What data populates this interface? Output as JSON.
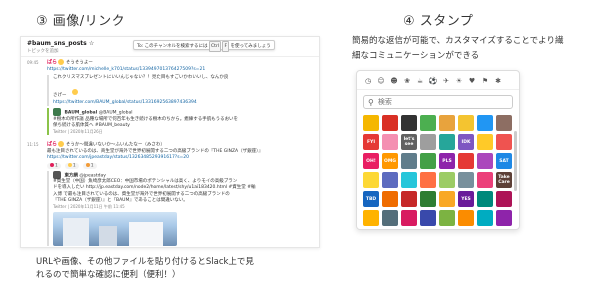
{
  "left": {
    "heading": "③ 画像/リンク",
    "channel_name": "#baum_sns_posts ☆",
    "channel_topic": "トピックを追加",
    "tooltip_pre": "To: このチャンネルを検索するには",
    "tooltip_key1": "Ctrl",
    "tooltip_key2": "F",
    "tooltip_post": "を使ってみましょう",
    "messages": [
      {
        "ts": "09:45",
        "author": "ぱら",
        "text": "そうそうよー",
        "link1": "https://twitter.com/michelle_k701/status/133949701376427509?s=21",
        "line1": "これクリスマスプレゼントにいいんじゃない？！見た目もすごいかわいいし、なんか良",
        "line2": "さげー",
        "link2": "https://twitter.com/BAUM_global/status/1331692563897436394",
        "quote_author": "BAUM_global",
        "quote_handle": "@BAUM_global",
        "quote_text1": "#樹木の所作謳 品種な場所で何百年も生き続ける樹木のちから。癒練する手肌もうるおいを",
        "quote_text2": "保ち続ける肌体質へ #BAUM_beauty",
        "quote_date": "Twitter | 2020年11月26日"
      },
      {
        "ts": "11:15",
        "author": "ぱら",
        "text": "そうか〜間違いないか〜ふいんたなー（みさわ）",
        "line1": "最も注目されているのは、商生堂が海外で世界初展開する二つの高級ブランドの『THE GINZA（ザ銀座）』",
        "link1": "https://twitter.com/jpeastday/status/1326348529391617?s=20",
        "r1": "1",
        "r2": "1",
        "r3": "1",
        "quote_author": "東方網",
        "quote_handle": "@jpeastday",
        "quote_text1": "#資生堂（中国）魚崎彦太郎CEO：中国市場のポテンシャルは高く、よりモイの高級ブラン",
        "quote_text2": "ドを導入したい http://jp.eastday.com/node2/home/latest/shy/u1ai183420.html #資生堂 #輸",
        "quote_text3": "入博 で最も注目されているのは、資生堂が海外で世界初展開する二つの高級ブランドの",
        "quote_text4": "『THE GINZA（ザ銀座）』と『BAUM』であることは間違いない。",
        "quote_date": "Twitter | 2020年11月11日 午前 11:45"
      }
    ],
    "caption_line1": "URLや画像、その他ファイルを貼り付けるとSlack上で見",
    "caption_line2": "れるので簡単な確認に便利（便利！）"
  },
  "right": {
    "heading": "④ スタンプ",
    "desc_line1": "簡易的な返信が可能で、カスタマイズすることでより繊",
    "desc_line2": "細なコミュニケーションができる",
    "search_placeholder": "検索",
    "category_icons": [
      "clock-icon",
      "smile-icon",
      "person-icon",
      "leaf-icon",
      "food-icon",
      "ball-icon",
      "car-icon",
      "bulb-icon",
      "heart-icon",
      "flag-icon",
      "slack-icon"
    ],
    "category_glyphs": [
      "◷",
      "☺",
      "☻",
      "❀",
      "☕",
      "⚽",
      "✈",
      "☀",
      "♥",
      "⚑",
      "✱"
    ],
    "emojis": [
      {
        "label": "",
        "color": "#f5b700"
      },
      {
        "label": "",
        "color": "#d93025"
      },
      {
        "label": "",
        "color": "#333333"
      },
      {
        "label": "",
        "color": "#4caf50"
      },
      {
        "label": "",
        "color": "#e8a33d"
      },
      {
        "label": "",
        "color": "#f4c430"
      },
      {
        "label": "",
        "color": "#2196f3"
      },
      {
        "label": "",
        "color": "#8d6e63"
      },
      {
        "label": "FYI",
        "color": "#e53935"
      },
      {
        "label": "",
        "color": "#f48fb1"
      },
      {
        "label": "let's see",
        "color": "#616161"
      },
      {
        "label": "",
        "color": "#9e9e9e"
      },
      {
        "label": "",
        "color": "#26a69a"
      },
      {
        "label": "IDK",
        "color": "#7e57c2"
      },
      {
        "label": "",
        "color": "#ffca28"
      },
      {
        "label": "",
        "color": "#ef5350"
      },
      {
        "label": "OH!",
        "color": "#e91e63"
      },
      {
        "label": "OMG",
        "color": "#ff9800"
      },
      {
        "label": "",
        "color": "#607d8b"
      },
      {
        "label": "",
        "color": "#43a047"
      },
      {
        "label": "PLS",
        "color": "#8e24aa"
      },
      {
        "label": "",
        "color": "#e53935"
      },
      {
        "label": "",
        "color": "#ab47bc"
      },
      {
        "label": "SAT",
        "color": "#1e88e5"
      },
      {
        "label": "",
        "color": "#fdd835"
      },
      {
        "label": "",
        "color": "#5c6bc0"
      },
      {
        "label": "",
        "color": "#26c6da"
      },
      {
        "label": "",
        "color": "#ff7043"
      },
      {
        "label": "",
        "color": "#9ccc65"
      },
      {
        "label": "",
        "color": "#78909c"
      },
      {
        "label": "",
        "color": "#ec407a"
      },
      {
        "label": "Take Care",
        "color": "#5d4037"
      },
      {
        "label": "TBD",
        "color": "#1565c0"
      },
      {
        "label": "",
        "color": "#ef6c00"
      },
      {
        "label": "",
        "color": "#c62828"
      },
      {
        "label": "",
        "color": "#2e7d32"
      },
      {
        "label": "",
        "color": "#f9a825"
      },
      {
        "label": "YES",
        "color": "#6a1b9a"
      },
      {
        "label": "",
        "color": "#00897b"
      },
      {
        "label": "",
        "color": "#ad1457"
      },
      {
        "label": "",
        "color": "#ffb300"
      },
      {
        "label": "",
        "color": "#546e7a"
      },
      {
        "label": "",
        "color": "#d81b60"
      },
      {
        "label": "",
        "color": "#3949ab"
      },
      {
        "label": "",
        "color": "#7cb342"
      },
      {
        "label": "",
        "color": "#fb8c00"
      },
      {
        "label": "",
        "color": "#00acc1"
      },
      {
        "label": "",
        "color": "#8e24aa"
      }
    ]
  }
}
